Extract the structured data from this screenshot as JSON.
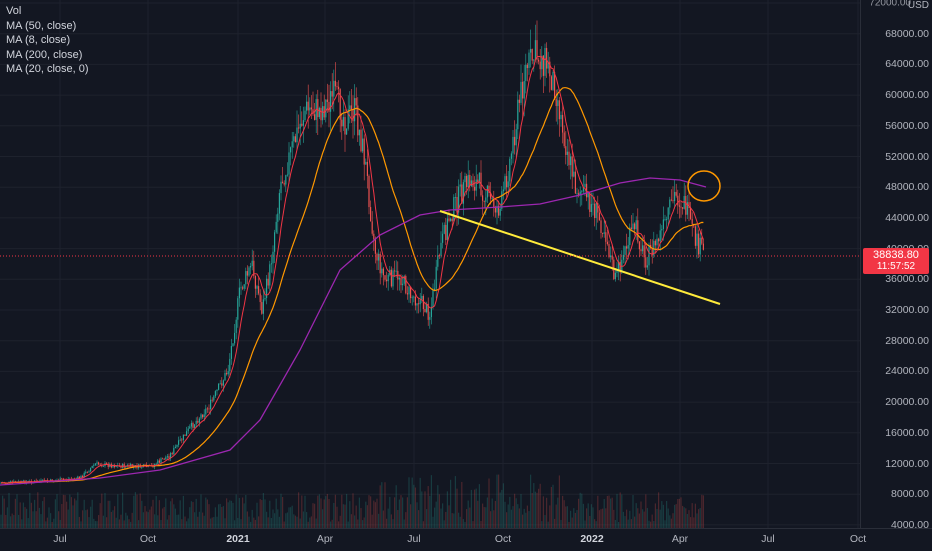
{
  "legend": {
    "volume": "Vol",
    "ma50": "MA (50, close)",
    "ma8": "MA (8, close)",
    "ma200": "MA (200, close)",
    "ma20": "MA (20, close, 0)"
  },
  "price_axis": {
    "currency": "USD",
    "ticks": [
      "72000.00",
      "68000.00",
      "64000.00",
      "60000.00",
      "56000.00",
      "52000.00",
      "48000.00",
      "44000.00",
      "40000.00",
      "36000.00",
      "32000.00",
      "28000.00",
      "24000.00",
      "20000.00",
      "16000.00",
      "12000.00",
      "8000.00",
      "4000.00"
    ]
  },
  "last_price": {
    "price": "38838.80",
    "countdown": "11:57:52"
  },
  "time_axis": {
    "ticks": [
      {
        "label": "Jul",
        "bold": false
      },
      {
        "label": "Oct",
        "bold": false
      },
      {
        "label": "2021",
        "bold": true
      },
      {
        "label": "Apr",
        "bold": false
      },
      {
        "label": "Jul",
        "bold": false
      },
      {
        "label": "Oct",
        "bold": false
      },
      {
        "label": "2022",
        "bold": true
      },
      {
        "label": "Apr",
        "bold": false
      },
      {
        "label": "Jul",
        "bold": false
      },
      {
        "label": "Oct",
        "bold": false
      }
    ]
  },
  "colors": {
    "background": "#131722",
    "candle_up": "#26a69a",
    "candle_down": "#ef5350",
    "ma8": "#f23645",
    "ma50": "#ff9800",
    "ma200": "#9c27b0",
    "trendline": "#ffeb3b",
    "annotation_circle": "#ff9800",
    "last_price": "#f23645"
  }
}
